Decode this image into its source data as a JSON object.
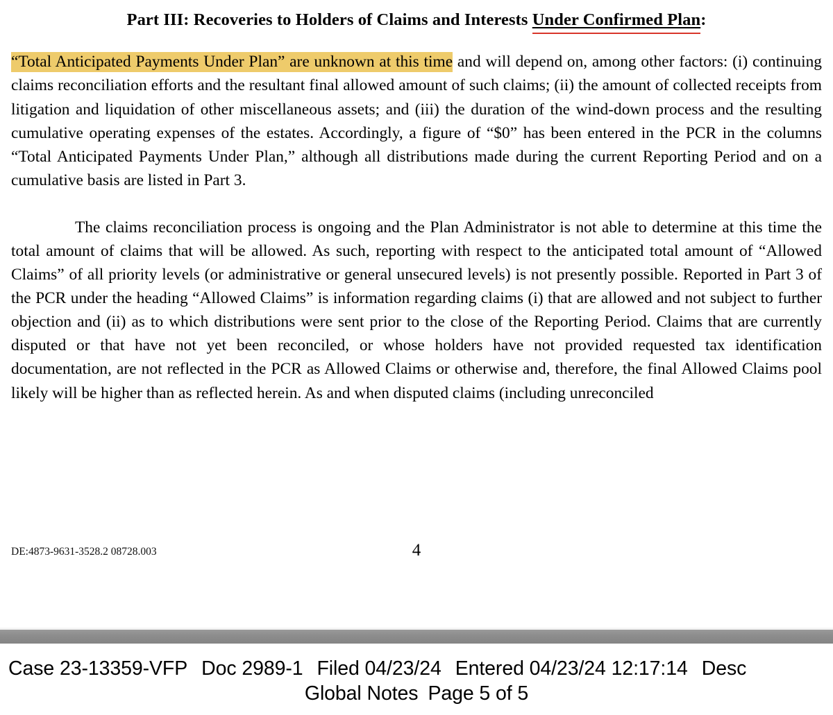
{
  "document": {
    "heading": {
      "lead": "Part III: Recoveries to Holders of Claims and Interests ",
      "underlined": "Under Confirmed Plan",
      "trail": ":",
      "underline_accent_color": "#d8352a"
    },
    "highlight_color": "#eecb6b",
    "paragraph_1": {
      "highlighted": "“Total Anticipated Payments Under Plan” are unknown at this time",
      "rest": " and will depend on, among other factors: (i) continuing claims reconciliation efforts and the resultant final allowed amount of such claims; (ii) the amount of collected receipts from litigation and liquidation of other miscellaneous assets; and (iii) the duration of the wind-down process and the resulting cumulative operating expenses of the estates.  Accordingly, a figure of “$0” has been entered in the PCR in the columns “Total Anticipated Payments Under Plan,” although all distributions made during the current Reporting Period and on a cumulative basis are listed in Part 3."
    },
    "paragraph_2": "The claims reconciliation process is ongoing and the Plan Administrator is not able to determine at this time the total amount of claims that will be allowed.  As such, reporting with respect to the anticipated total amount of “Allowed Claims” of all priority levels (or administrative or general unsecured levels) is not presently possible. Reported in Part 3 of the PCR under the heading “Allowed Claims” is information regarding claims (i) that are allowed and not subject to further objection and (ii) as to which distributions were sent prior to the close of the Reporting Period. Claims that are currently disputed or that have not yet been reconciled, or whose holders have not provided requested tax identification documentation, are not reflected in the PCR as Allowed Claims or otherwise and, therefore, the final Allowed Claims pool likely will be higher than as reflected herein.  As and when disputed claims (including unreconciled",
    "footer": {
      "reference": "DE:4873-9631-3528.2 08728.003",
      "page_number": "4"
    }
  },
  "separator": {
    "bar_color": "#8d8d8d"
  },
  "ecf_stamp": {
    "case": "Case 23-13359-VFP",
    "doc": "Doc 2989-1",
    "filed": "Filed 04/23/24",
    "entered": "Entered 04/23/24 12:17:14",
    "description_truncated": "Desc",
    "attachment_title": "Global Notes",
    "page_of": "Page 5 of 5"
  }
}
